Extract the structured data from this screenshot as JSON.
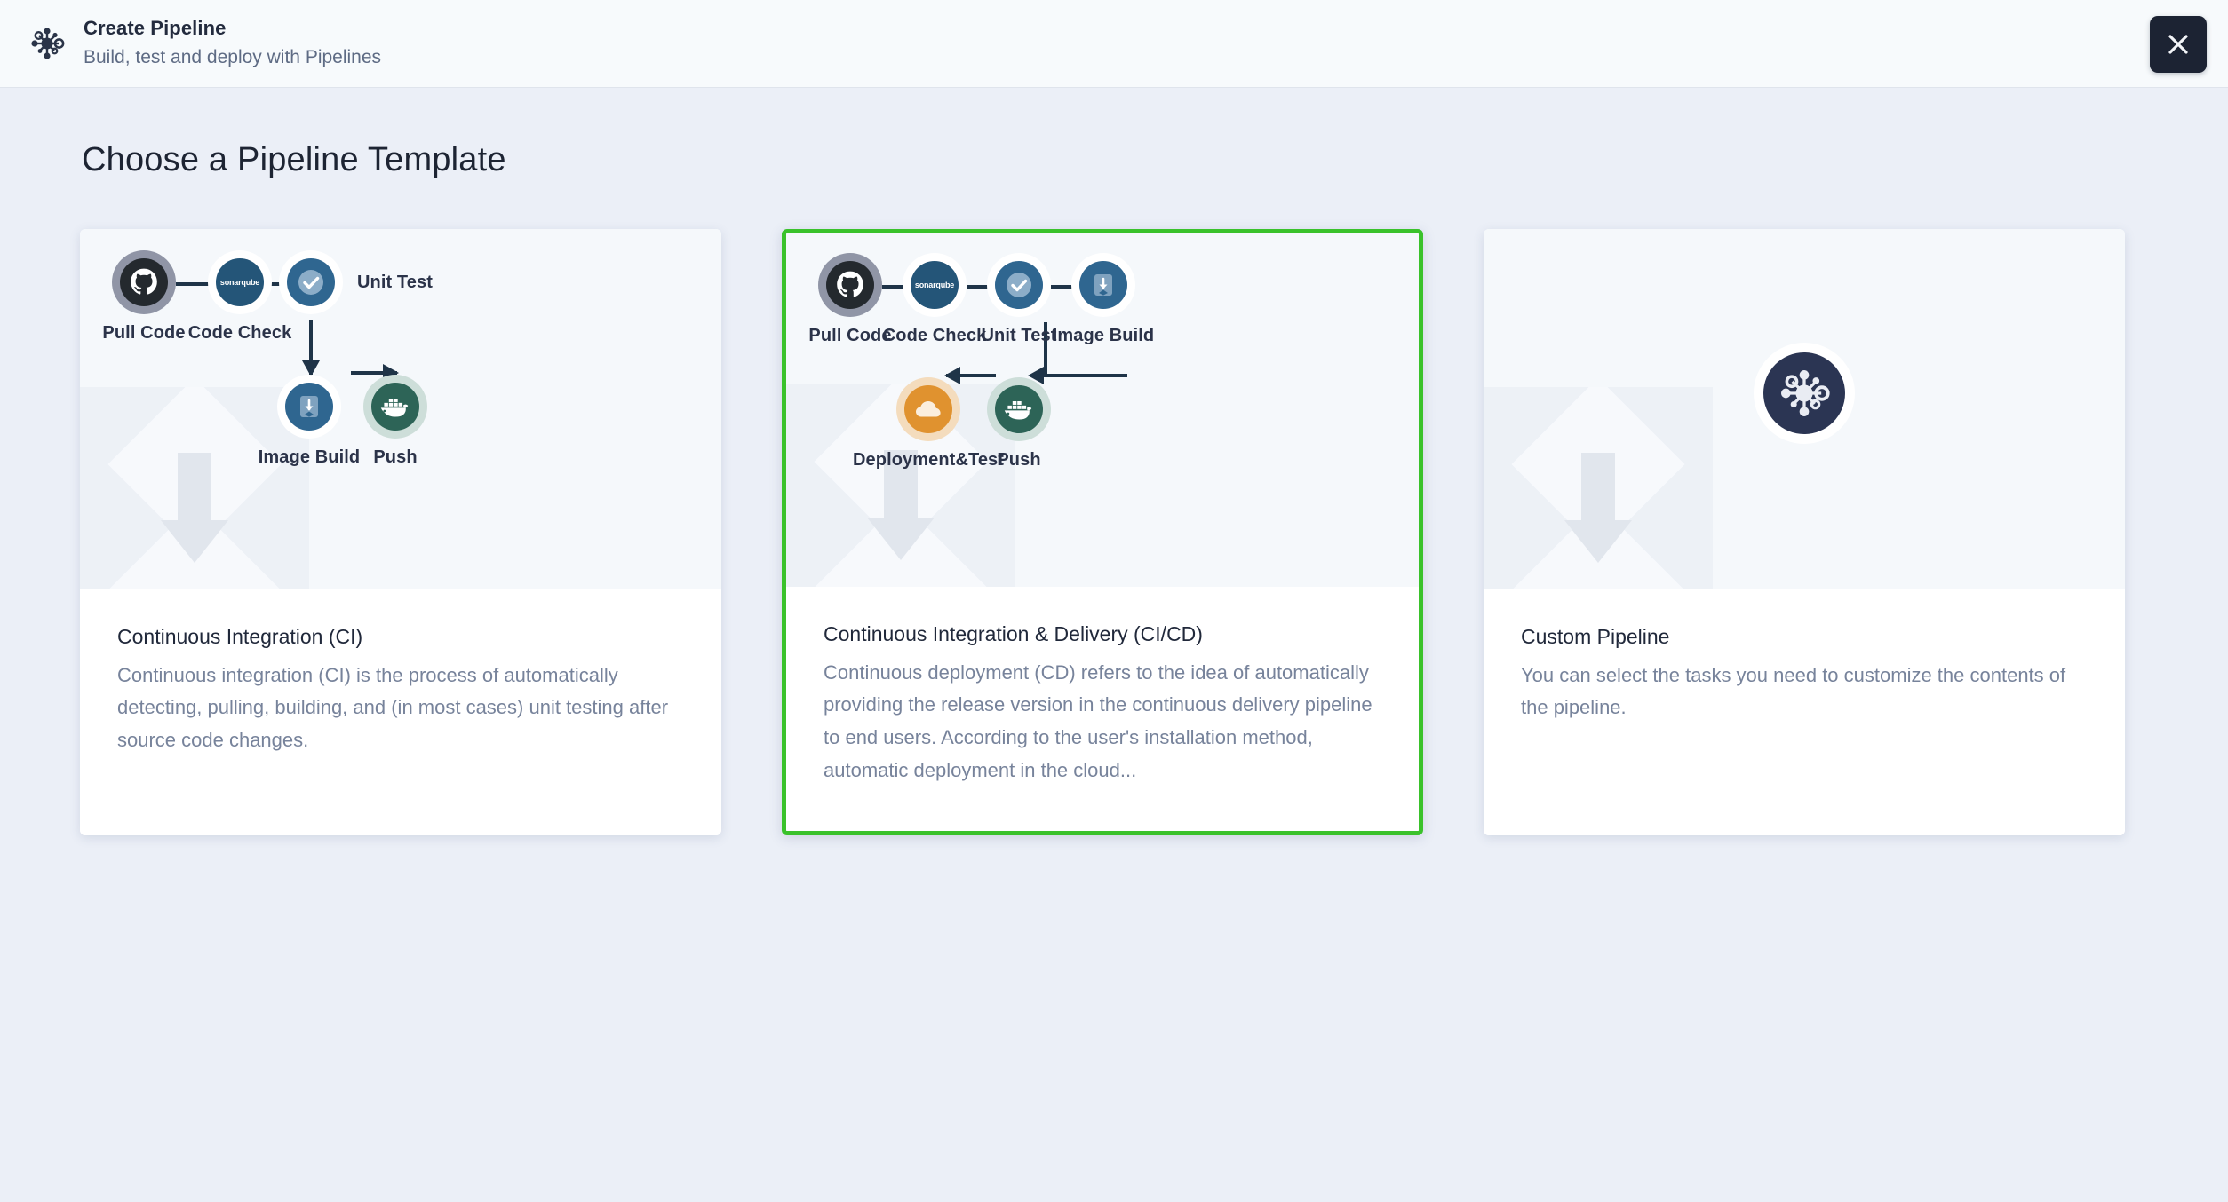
{
  "header": {
    "logo_icon": "pipeline-network-icon",
    "title": "Create Pipeline",
    "subtitle": "Build, test and deploy with Pipelines",
    "close_icon": "close-icon"
  },
  "page": {
    "title": "Choose a Pipeline Template"
  },
  "colors": {
    "background": "#ebeff7",
    "header_background": "#f7fafc",
    "selected_border": "#3ac22b",
    "close_button": "#1c2333",
    "preview_background": "#f5f8fb",
    "github": "#24292e",
    "sonarqube": "#245578",
    "unit_test": "#2f6690",
    "image_build": "#2f6690",
    "docker_push": "#2d6457",
    "deployment_cloud": "#e0922f",
    "custom_logo": "#2b3553",
    "arrow": "#1f3448",
    "heading_text": "#20283a",
    "body_text": "#77839b"
  },
  "cards": [
    {
      "id": "ci",
      "selected": false,
      "heading": "Continuous Integration (CI)",
      "description": "Continuous integration (CI) is the process of automatically detecting, pulling, building, and (in most cases) unit testing after source code changes.",
      "nodes": [
        {
          "label": "Pull Code",
          "icon": "github-icon"
        },
        {
          "label": "Code Check",
          "icon": "sonarqube-icon"
        },
        {
          "label": "Unit Test",
          "icon": "check-circle-icon"
        },
        {
          "label": "Image Build",
          "icon": "image-build-icon"
        },
        {
          "label": "Push",
          "icon": "docker-icon"
        }
      ]
    },
    {
      "id": "cicd",
      "selected": true,
      "heading": "Continuous Integration & Delivery (CI/CD)",
      "description": "Continuous deployment (CD) refers to the idea of automatically providing the release version in the continuous delivery pipeline to end users. According to the user's installation method, automatic deployment in the cloud...",
      "nodes": [
        {
          "label": "Pull Code",
          "icon": "github-icon"
        },
        {
          "label": "Code Check",
          "icon": "sonarqube-icon"
        },
        {
          "label": "Unit Test",
          "icon": "check-circle-icon"
        },
        {
          "label": "Image Build",
          "icon": "image-build-icon"
        },
        {
          "label": "Push",
          "icon": "docker-icon"
        },
        {
          "label": "Deployment&Test",
          "icon": "cloud-icon"
        }
      ]
    },
    {
      "id": "custom",
      "selected": false,
      "heading": "Custom Pipeline",
      "description": "You can select the tasks you need to customize the contents of the pipeline.",
      "logo_icon": "pipeline-network-icon",
      "nodes": []
    }
  ]
}
